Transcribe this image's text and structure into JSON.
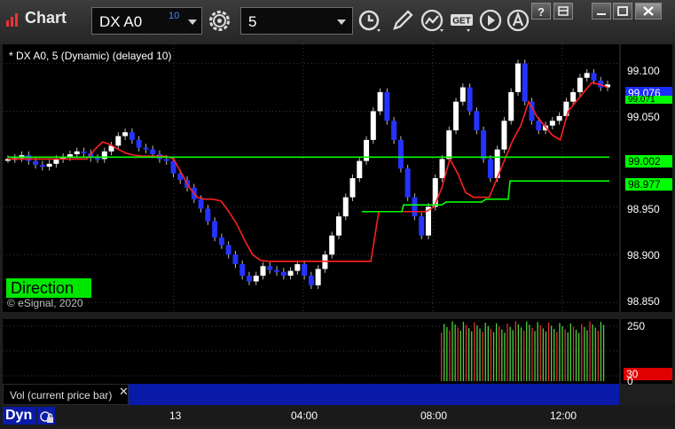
{
  "window": {
    "title": "Chart"
  },
  "toolbar": {
    "symbol": "DX A0",
    "symbol_superscript": "10",
    "interval": "5",
    "icons": [
      "settings-gear-icon",
      "clock-icon",
      "pencil-icon",
      "study-icon",
      "get-icon",
      "play-icon",
      "alert-icon"
    ]
  },
  "chart": {
    "legend": "* DX A0, 5 (Dynamic) (delayed 10)",
    "direction_label": "Direction",
    "copyright": "© eSignal, 2020",
    "price_labels": [
      "99.100",
      "99.050",
      "98.950",
      "98.900",
      "98.850"
    ],
    "markers": {
      "last": "99.076",
      "green_hidden": "99.071",
      "level1": "99.002",
      "level2": "98.977"
    },
    "colors": {
      "up": "#ffffff",
      "down": "#2433ff",
      "red_line": "#ff2020",
      "green_line": "#00ff00",
      "marker_blue": "#1a2dff",
      "marker_green": "#00ff00"
    }
  },
  "volume": {
    "label": "Vol (current price bar)",
    "close": "✕",
    "scale_top": "250",
    "scale_bottom": "0",
    "current": "30"
  },
  "bottom": {
    "dyn_label": "Dyn",
    "time_labels": [
      "13",
      "04:00",
      "08:00",
      "12:00"
    ]
  },
  "chart_data": {
    "type": "candlestick",
    "symbol": "DX A0",
    "interval": "5",
    "ylim": [
      98.84,
      99.12
    ],
    "y_ticks": [
      99.1,
      99.05,
      98.95,
      98.9,
      98.85
    ],
    "x_ticks": [
      "13",
      "04:00",
      "08:00",
      "12:00"
    ],
    "close_path": [
      99.0,
      99.001,
      99.004,
      98.998,
      98.994,
      98.992,
      98.995,
      99.0,
      99.002,
      99.005,
      99.008,
      99.006,
      99.001,
      99.0,
      99.008,
      99.014,
      99.024,
      99.028,
      99.02,
      99.012,
      99.01,
      99.005,
      99.0,
      98.998,
      98.985,
      98.978,
      98.97,
      98.958,
      98.948,
      98.935,
      98.918,
      98.91,
      98.9,
      98.89,
      98.878,
      98.872,
      98.878,
      98.888,
      98.884,
      98.882,
      98.878,
      98.883,
      98.89,
      98.878,
      98.868,
      98.885,
      98.9,
      98.92,
      98.94,
      98.96,
      98.98,
      98.998,
      99.02,
      99.05,
      99.07,
      99.04,
      99.02,
      98.99,
      98.96,
      98.94,
      98.92,
      98.95,
      98.98,
      99.0,
      99.03,
      99.06,
      99.075,
      99.05,
      99.03,
      99.0,
      98.98,
      99.01,
      99.04,
      99.07,
      99.1,
      99.06,
      99.04,
      99.03,
      99.035,
      99.04,
      99.045,
      99.06,
      99.07,
      99.085,
      99.09,
      99.082,
      99.075,
      99.078
    ],
    "series": [
      {
        "name": "",
        "color": "red",
        "values": [
          99.0,
          99.0,
          99.0,
          99.0,
          99.0,
          99.0,
          99.0,
          99.0,
          99.0,
          99.0,
          99.0,
          99.01,
          99.018,
          99.015,
          99.01,
          99.006,
          99.004,
          99.003,
          99.003,
          99.003,
          99.003,
          99.0,
          98.985,
          98.97,
          98.96,
          98.958,
          98.958,
          98.956,
          98.945,
          98.932,
          98.915,
          98.9,
          98.894,
          98.893,
          98.893,
          98.893,
          98.893,
          98.893,
          98.893,
          98.893,
          98.893,
          98.893,
          98.893,
          98.893,
          98.893,
          98.893,
          98.893,
          98.945,
          98.945,
          98.945,
          98.945,
          98.945,
          98.945,
          98.945,
          98.95,
          98.97,
          99.0,
          98.985,
          98.965,
          98.96,
          98.96,
          98.96,
          98.98,
          99.0,
          99.02,
          99.035,
          99.06,
          99.045,
          99.035,
          99.025,
          99.02,
          99.05,
          99.06,
          99.07,
          99.08,
          99.078,
          99.075
        ]
      },
      {
        "name": "",
        "color": "green",
        "values": [
          99.002,
          99.002,
          99.002,
          99.002,
          99.002,
          99.002,
          99.002,
          99.002,
          99.002,
          99.002,
          99.002,
          99.002,
          99.002,
          99.002,
          99.002,
          99.002,
          99.002,
          99.002,
          99.002,
          99.002,
          99.002,
          99.002,
          99.002,
          99.002,
          99.002,
          99.002,
          99.002,
          99.002,
          99.002,
          99.002,
          99.002,
          99.002,
          99.002
        ]
      }
    ],
    "volume": {
      "ylim": [
        0,
        250
      ],
      "current": 30
    }
  }
}
